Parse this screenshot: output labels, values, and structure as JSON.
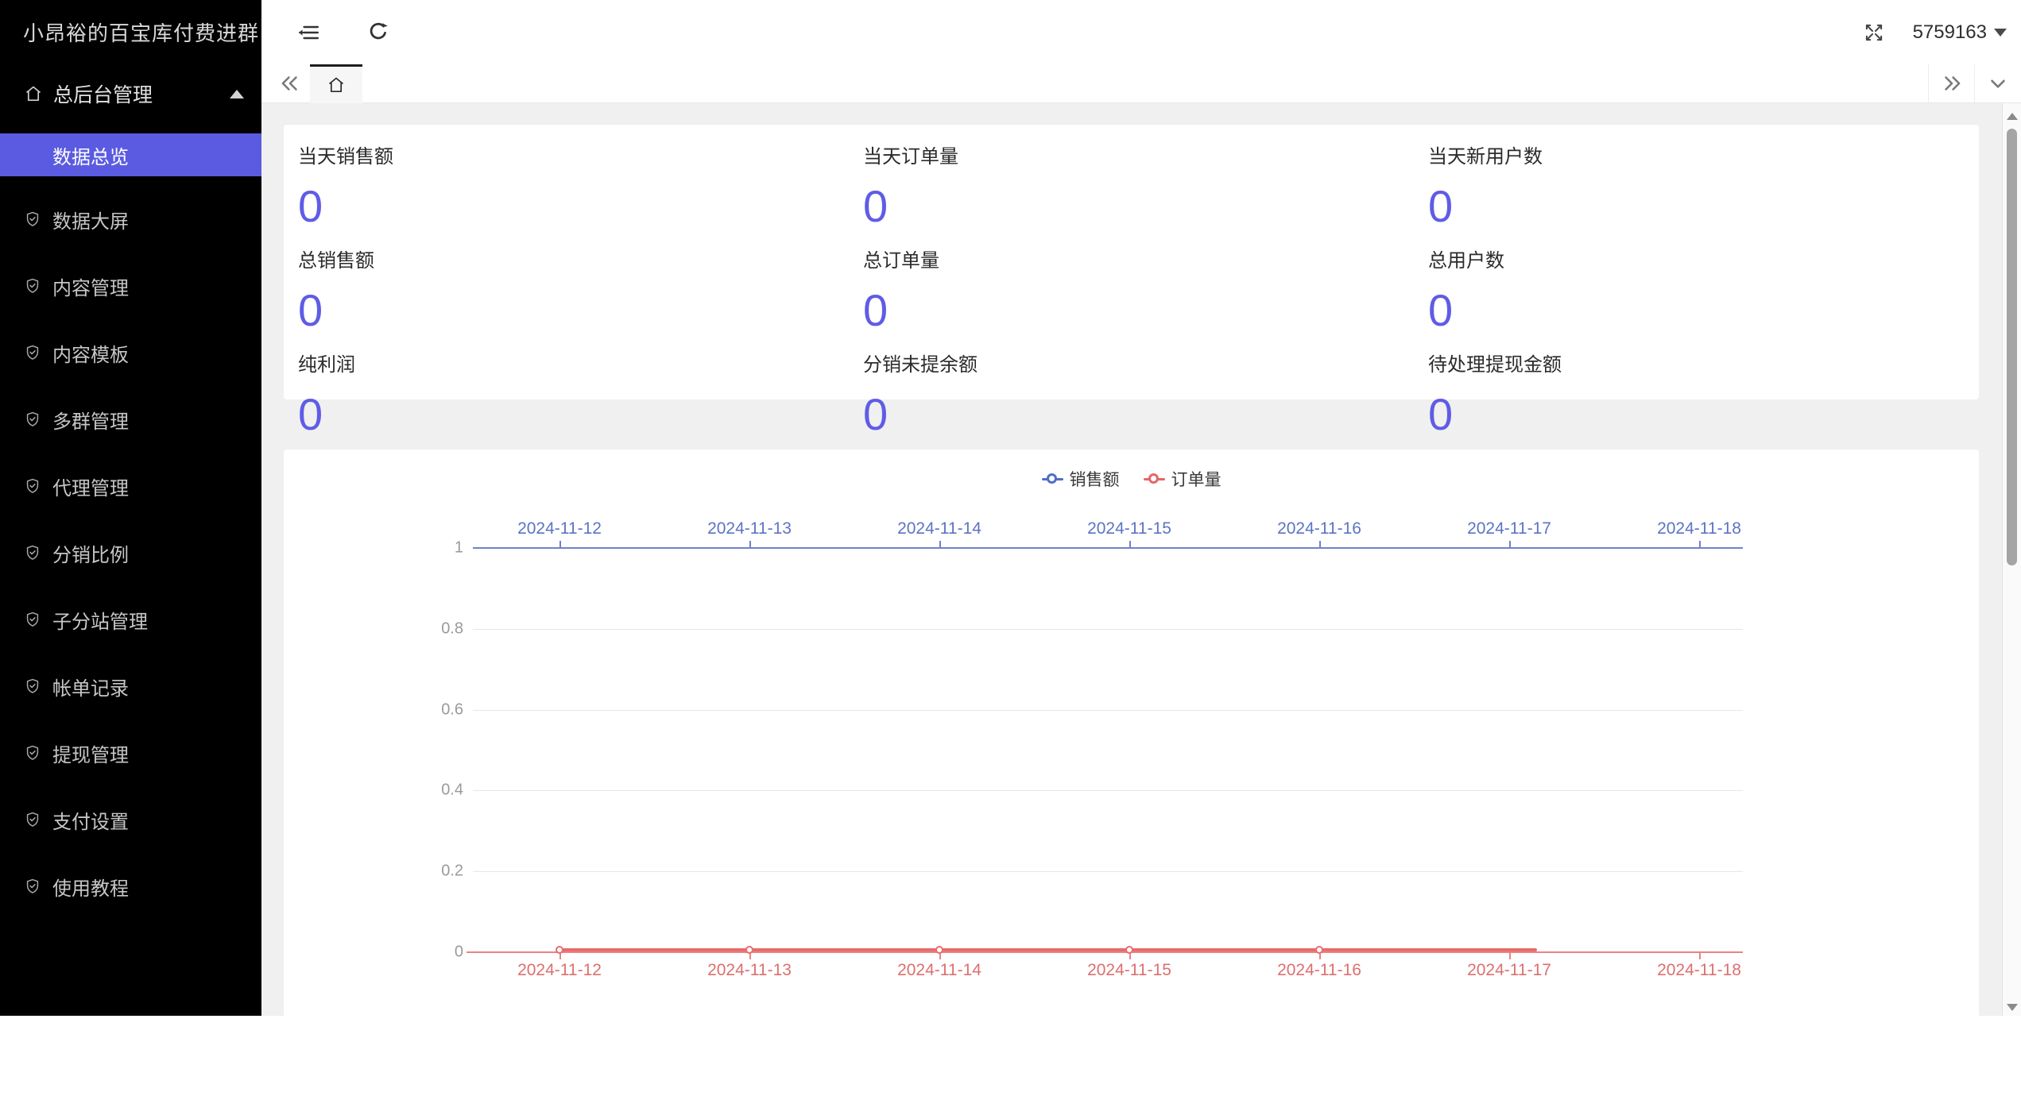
{
  "sidebar": {
    "title": "小昂裕的百宝库付费进群",
    "section_label": "总后台管理",
    "active_item": "数据总览",
    "items": [
      "数据大屏",
      "内容管理",
      "内容模板",
      "多群管理",
      "代理管理",
      "分销比例",
      "子分站管理",
      "帐单记录",
      "提现管理",
      "支付设置",
      "使用教程"
    ]
  },
  "topbar": {
    "user_id": "5759163"
  },
  "stats": {
    "cards": [
      {
        "label": "当天销售额",
        "value": "0"
      },
      {
        "label": "当天订单量",
        "value": "0"
      },
      {
        "label": "当天新用户数",
        "value": "0"
      },
      {
        "label": "总销售额",
        "value": "0"
      },
      {
        "label": "总订单量",
        "value": "0"
      },
      {
        "label": "总用户数",
        "value": "0"
      },
      {
        "label": "纯利润",
        "value": "0"
      },
      {
        "label": "分销未提余额",
        "value": "0"
      },
      {
        "label": "待处理提现金额",
        "value": "0"
      }
    ]
  },
  "chart_data": {
    "type": "line",
    "categories": [
      "2024-11-12",
      "2024-11-13",
      "2024-11-14",
      "2024-11-15",
      "2024-11-16",
      "2024-11-17",
      "2024-11-18"
    ],
    "series": [
      {
        "name": "销售额",
        "color": "#5470c6",
        "axis": "top",
        "values": [
          0,
          0,
          0,
          0,
          0,
          0
        ]
      },
      {
        "name": "订单量",
        "color": "#ee6666",
        "axis": "bottom",
        "values": [
          0,
          0,
          0,
          0,
          0,
          0
        ]
      }
    ],
    "ylim": [
      0,
      1
    ],
    "y_ticks": [
      0,
      0.2,
      0.4,
      0.6,
      0.8,
      1
    ],
    "grid": true,
    "legend_position": "top-center"
  },
  "colors": {
    "sidebar_bg": "#000000",
    "accent_purple": "#5a5be0",
    "stat_value_purple": "#5f5ce6",
    "content_bg": "#f0f0f0",
    "chart_blue": "#5470c6",
    "chart_red": "#ee6666"
  }
}
